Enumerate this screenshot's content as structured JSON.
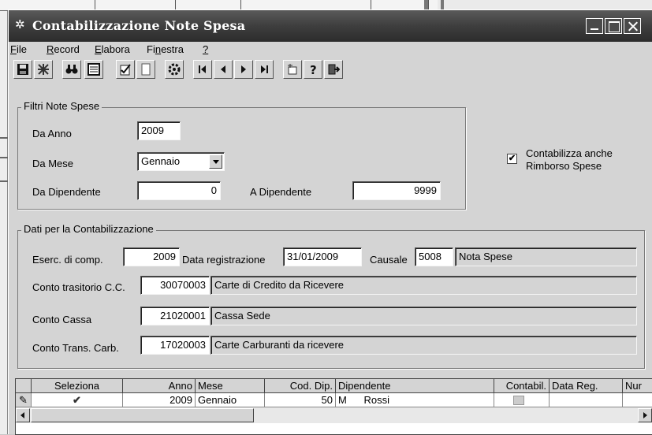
{
  "window": {
    "title": "Contabilizzazione Note Spesa"
  },
  "menu": [
    {
      "label": "File",
      "mnemonic": "F",
      "rest": "ile"
    },
    {
      "label": "Record",
      "mnemonic": "R",
      "rest": "ecord"
    },
    {
      "label": "Elabora",
      "mnemonic": "E",
      "rest": "labora"
    },
    {
      "label": "Finestra",
      "pre": "Fi",
      "mnemonic": "n",
      "rest": "estra"
    },
    {
      "label": "?",
      "mnemonic": "?",
      "rest": ""
    }
  ],
  "toolbar": {
    "icons": [
      "save-icon",
      "cancel-icon",
      "find-icon",
      "list-icon",
      "confirm-icon",
      "blank-icon",
      "process-icon",
      "first-record-icon",
      "previous-record-icon",
      "next-record-icon",
      "last-record-icon",
      "new-window-icon",
      "help-icon",
      "exit-icon"
    ]
  },
  "filters": {
    "group_label": "Filtri Note Spese",
    "da_anno_label": "Da Anno",
    "da_anno_value": "2009",
    "da_mese_label": "Da Mese",
    "da_mese_value": "Gennaio",
    "da_dipendente_label": "Da Dipendente",
    "da_dipendente_value": "0",
    "a_dipendente_label": "A Dipendente",
    "a_dipendente_value": "9999"
  },
  "contabilizza_rimborso": {
    "checked": true,
    "mark": "✔",
    "label_line1": "Contabilizza anche",
    "label_line2": "Rimborso Spese"
  },
  "dati": {
    "group_label": "Dati per la Contabilizzazione",
    "eserc_label": "Eserc. di comp.",
    "eserc_value": "2009",
    "data_reg_label": "Data registrazione",
    "data_reg_value": "31/01/2009",
    "causale_label": "Causale",
    "causale_code": "5008",
    "causale_desc": "Nota Spese",
    "conto_trans_cc_label": "Conto trasitorio C.C.",
    "conto_trans_cc_code": "30070003",
    "conto_trans_cc_desc": "Carte di Credito da Ricevere",
    "conto_cassa_label": "Conto Cassa",
    "conto_cassa_code": "21020001",
    "conto_cassa_desc": "Cassa Sede",
    "conto_carb_label": "Conto Trans. Carb.",
    "conto_carb_code": "17020003",
    "conto_carb_desc": "Carte Carburanti da ricevere"
  },
  "grid": {
    "columns": [
      "",
      "Seleziona",
      "Anno",
      "Mese",
      "Cod. Dip.",
      "Dipendente",
      "Contabil.",
      "Data Reg.",
      "Nur"
    ],
    "rows": [
      {
        "indicator": "✎",
        "seleziona": "✔",
        "anno": "2009",
        "mese": "Gennaio",
        "cod_dip": "50",
        "dipendente": "M      Rossi",
        "contabil": "",
        "data_reg": "",
        "num": ""
      }
    ]
  }
}
